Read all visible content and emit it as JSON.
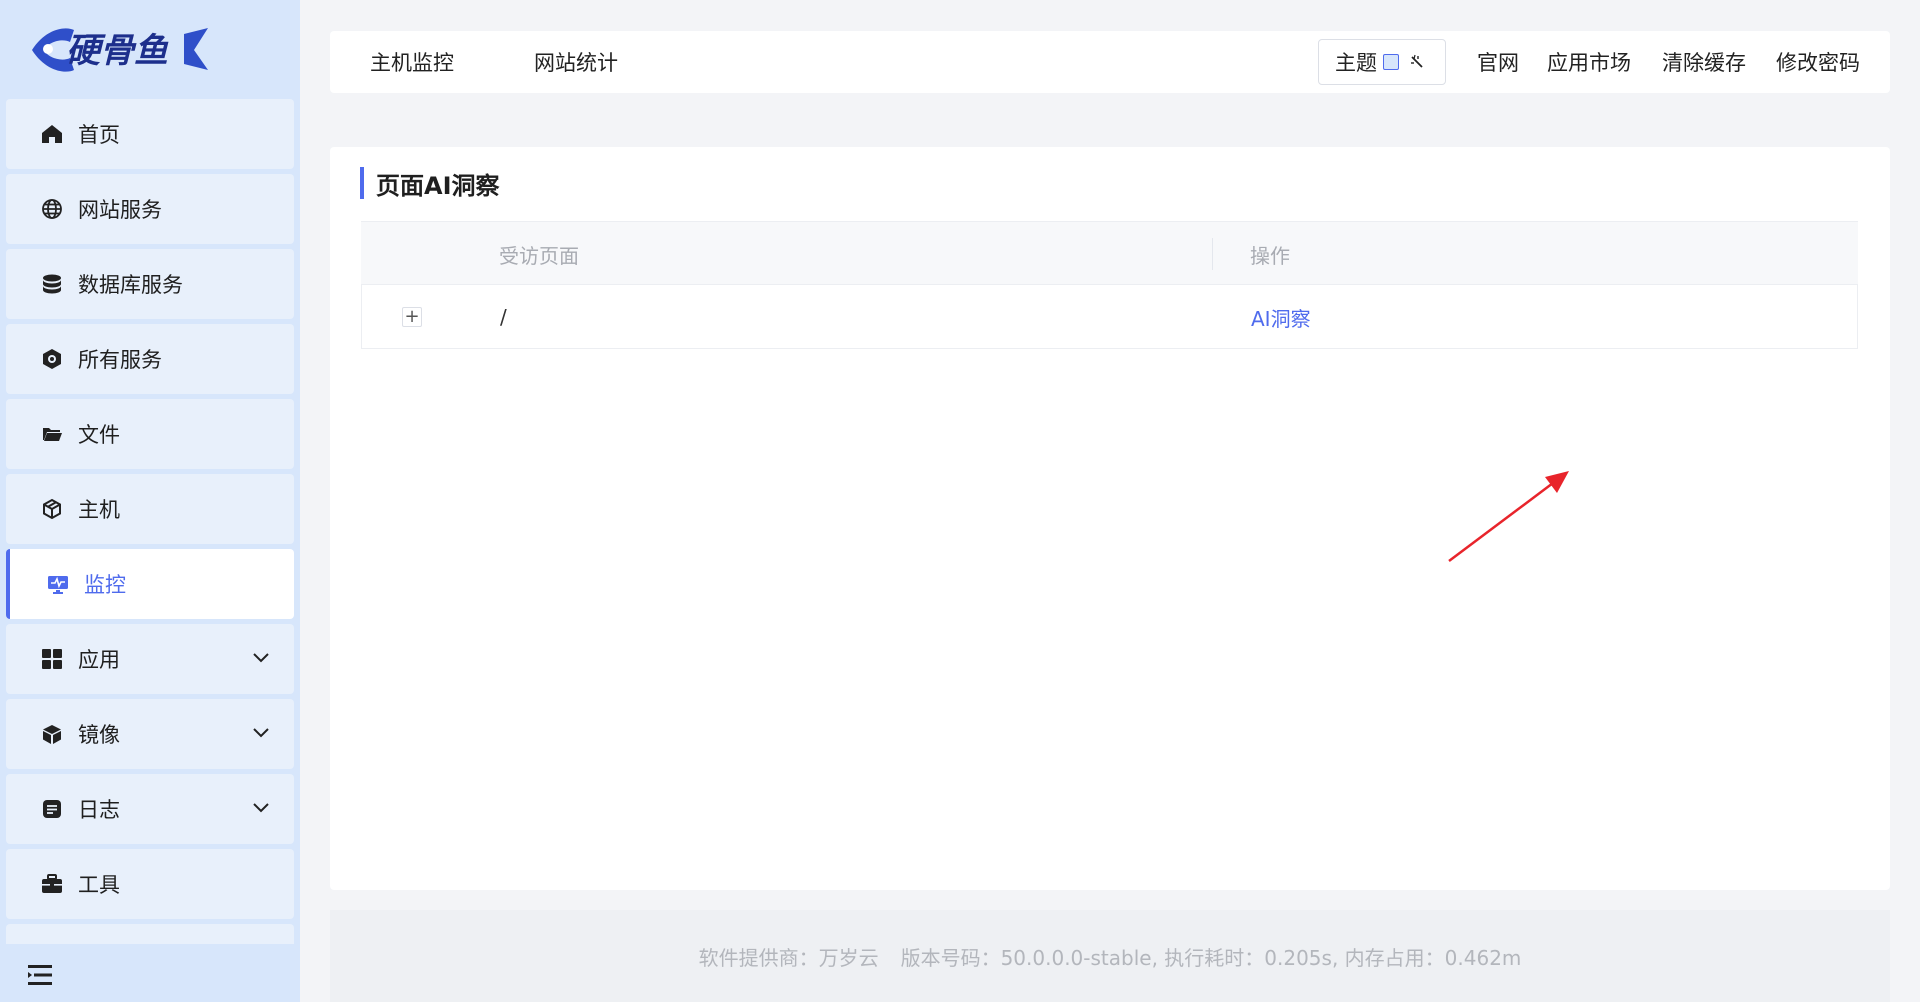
{
  "app": {
    "logo_text": "硬骨鱼"
  },
  "sidebar": {
    "items": [
      {
        "label": "首页",
        "icon": "home-icon"
      },
      {
        "label": "网站服务",
        "icon": "globe-icon"
      },
      {
        "label": "数据库服务",
        "icon": "database-icon"
      },
      {
        "label": "所有服务",
        "icon": "hexagon-services-icon"
      },
      {
        "label": "文件",
        "icon": "folder-icon"
      },
      {
        "label": "主机",
        "icon": "cube-host-icon"
      },
      {
        "label": "监控",
        "icon": "monitor-icon",
        "active": true
      },
      {
        "label": "应用",
        "icon": "grid-apps-icon",
        "expandable": true
      },
      {
        "label": "镜像",
        "icon": "box-image-icon",
        "expandable": true
      },
      {
        "label": "日志",
        "icon": "log-icon",
        "expandable": true
      },
      {
        "label": "工具",
        "icon": "toolbox-icon"
      }
    ],
    "collapse_icon": "menu-collapse-icon"
  },
  "topbar": {
    "tabs": [
      "主机监控",
      "网站统计"
    ],
    "theme_label": "主题",
    "links": [
      "官网",
      "应用市场",
      "清除缓存",
      "修改密码"
    ]
  },
  "main": {
    "title": "页面AI洞察",
    "table": {
      "headers": [
        "受访页面",
        "操作"
      ],
      "rows": [
        {
          "page": "/",
          "action": "AI洞察"
        }
      ]
    }
  },
  "footer": {
    "provider": "软件提供商：万岁云",
    "info": "版本号码：50.0.0.0-stable, 执行耗时：0.205s, 内存占用：0.462m"
  },
  "colors": {
    "accent": "#4f6bed",
    "sidebar_bg": "#d7e6fb",
    "annotation_arrow": "#e8242b"
  }
}
